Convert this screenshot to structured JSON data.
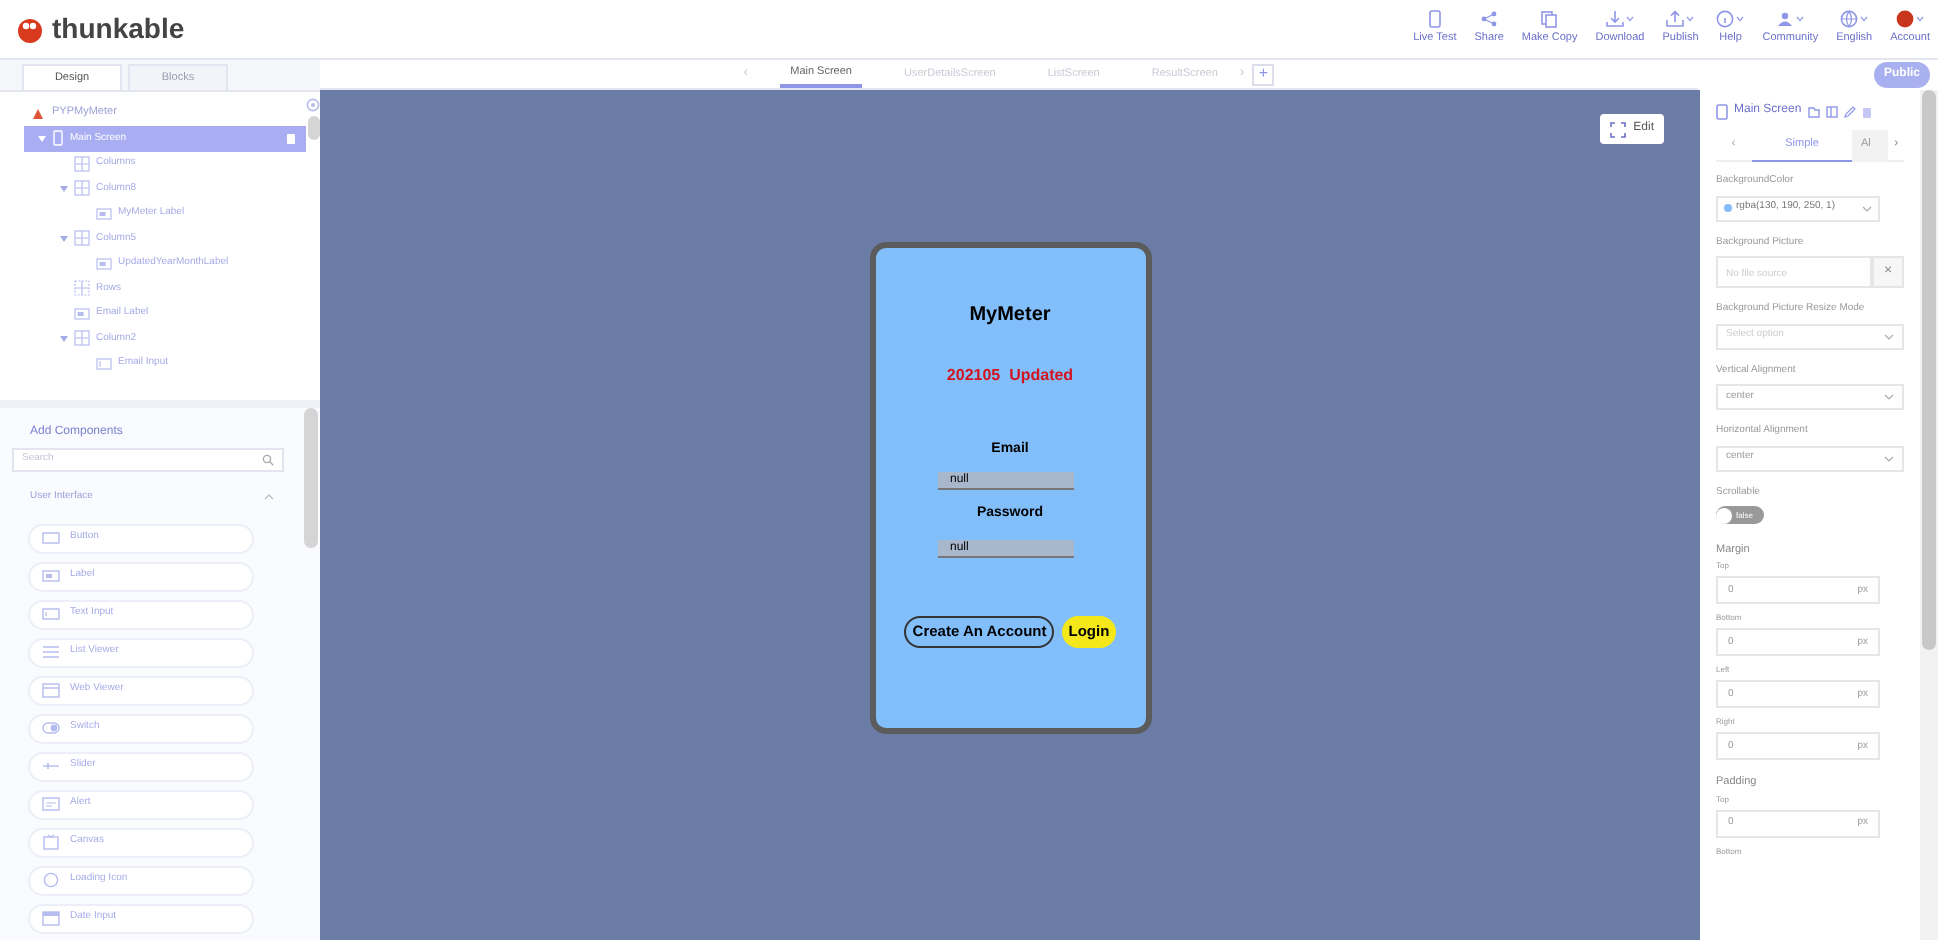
{
  "app": {
    "logo": "thunkable"
  },
  "toolbar": [
    {
      "label": "Live Test",
      "kind": "phone"
    },
    {
      "label": "Share",
      "kind": "share"
    },
    {
      "label": "Make Copy",
      "kind": "copy"
    },
    {
      "label": "Download",
      "kind": "download"
    },
    {
      "label": "Publish",
      "kind": "upload"
    },
    {
      "label": "Help",
      "kind": "info"
    },
    {
      "label": "Community",
      "kind": "people"
    },
    {
      "label": "English",
      "kind": "globe"
    },
    {
      "label": "Account",
      "kind": "avatar"
    }
  ],
  "visibility_badge": "Public",
  "panel_tabs": [
    {
      "label": "Design",
      "selected": true
    },
    {
      "label": "Blocks",
      "selected": false
    }
  ],
  "screen_tabs": {
    "prev": "‹",
    "next": "›",
    "add": "+",
    "tabs": [
      {
        "label": "Main Screen",
        "selected": true
      },
      {
        "label": "UserDetailsScreen",
        "selected": false
      },
      {
        "label": "ListScreen",
        "selected": false
      },
      {
        "label": "ResultScreen",
        "selected": false
      }
    ]
  },
  "tree": {
    "project": "PYPMyMeter",
    "items": [
      {
        "label": "Main Screen",
        "kind": "screen",
        "selected": true,
        "expanded": true,
        "children": [
          {
            "label": "Columns",
            "kind": "columns",
            "selected": false
          },
          {
            "label": "Column8",
            "kind": "columns",
            "selected": false,
            "expanded": true,
            "children": [
              {
                "label": "MyMeter Label",
                "kind": "label",
                "selected": false
              }
            ]
          },
          {
            "label": "Column5",
            "kind": "columns",
            "selected": false,
            "expanded": true,
            "children": [
              {
                "label": "UpdatedYearMonthLabel",
                "kind": "label",
                "selected": false
              }
            ]
          },
          {
            "label": "Rows",
            "kind": "rows",
            "selected": false
          },
          {
            "label": "Email Label",
            "kind": "label",
            "selected": false
          },
          {
            "label": "Column2",
            "kind": "columns",
            "selected": false,
            "expanded": true,
            "children": [
              {
                "label": "Email Input",
                "kind": "input",
                "selected": false
              }
            ]
          }
        ]
      }
    ]
  },
  "add_components": {
    "title": "Add Components",
    "search_placeholder": "Search",
    "category": "User Interface",
    "items": [
      {
        "label": "Button",
        "kind": "button"
      },
      {
        "label": "Label",
        "kind": "label"
      },
      {
        "label": "Text Input",
        "kind": "input"
      },
      {
        "label": "List Viewer",
        "kind": "list"
      },
      {
        "label": "Web Viewer",
        "kind": "web"
      },
      {
        "label": "Switch",
        "kind": "switch"
      },
      {
        "label": "Slider",
        "kind": "slider"
      },
      {
        "label": "Alert",
        "kind": "alert"
      },
      {
        "label": "Canvas",
        "kind": "canvas"
      },
      {
        "label": "Loading Icon",
        "kind": "loading"
      },
      {
        "label": "Date Input",
        "kind": "date"
      }
    ]
  },
  "canvas": {
    "edit_button": "Edit",
    "phone": {
      "title": "MyMeter",
      "updated": "202105  Updated",
      "email_label": "Email",
      "email_value": "null",
      "password_label": "Password",
      "password_value": "null",
      "buttons": [
        {
          "label": "Create An Account",
          "kind": "outline"
        },
        {
          "label": "Login",
          "kind": "filled"
        }
      ]
    }
  },
  "properties": {
    "title": "Main Screen",
    "prev": "‹",
    "next": "›",
    "tabs": [
      {
        "label": "Simple",
        "selected": true
      },
      {
        "label": "Al",
        "selected": false
      }
    ],
    "fields": [
      {
        "kind": "color",
        "label": "BackgroundColor",
        "value": "rgba(130, 190, 250, 1)",
        "color": "#82befa"
      },
      {
        "kind": "file",
        "label": "Background Picture",
        "placeholder": "No file source",
        "clear": "×"
      },
      {
        "kind": "select",
        "label": "Background Picture Resize Mode",
        "placeholder": "Select option"
      },
      {
        "kind": "select",
        "label": "Vertical Alignment",
        "value": "center"
      },
      {
        "kind": "select",
        "label": "Horizontal Alignment",
        "value": "center"
      },
      {
        "kind": "toggle",
        "label": "Scrollable",
        "value": "false",
        "on": false
      },
      {
        "kind": "section",
        "label": "Margin"
      },
      {
        "kind": "number",
        "label": "Top",
        "value": "0",
        "unit": "px"
      },
      {
        "kind": "number",
        "label": "Bottom",
        "value": "0",
        "unit": "px"
      },
      {
        "kind": "number",
        "label": "Left",
        "value": "0",
        "unit": "px"
      },
      {
        "kind": "number",
        "label": "Right",
        "value": "0",
        "unit": "px"
      },
      {
        "kind": "section",
        "label": "Padding"
      },
      {
        "kind": "number",
        "label": "Top",
        "value": "0",
        "unit": "px"
      },
      {
        "kind": "label",
        "label": "Bottom"
      }
    ]
  }
}
